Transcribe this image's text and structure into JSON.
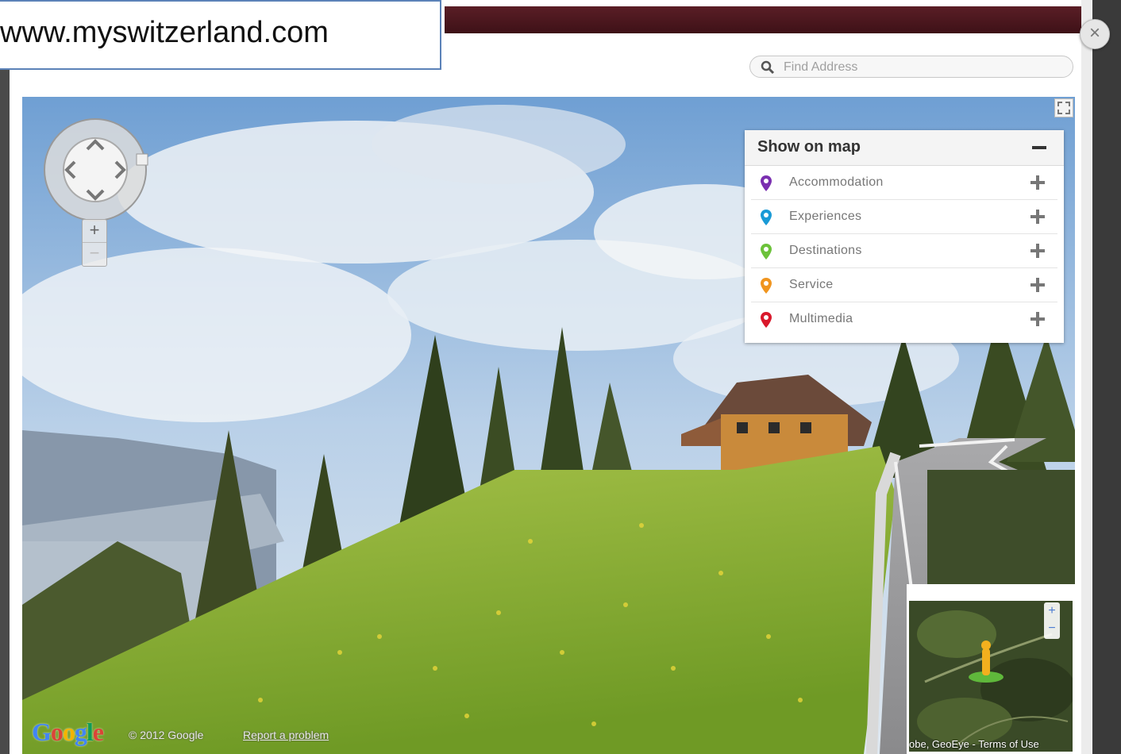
{
  "caption": {
    "url": "www.myswitzerland.com"
  },
  "search": {
    "placeholder": "Find Address",
    "icon": "search-icon"
  },
  "window": {
    "close_label": "×"
  },
  "poi_panel": {
    "title": "Show on map",
    "items": [
      {
        "label": "Accommodation",
        "color": "#7a2fb0"
      },
      {
        "label": "Experiences",
        "color": "#1a9ad6"
      },
      {
        "label": "Destinations",
        "color": "#6cc23a"
      },
      {
        "label": "Service",
        "color": "#f0951f"
      },
      {
        "label": "Multimedia",
        "color": "#d9182b"
      }
    ]
  },
  "streetview": {
    "zoom_in": "+",
    "zoom_out": "−",
    "logo": "Google",
    "copyright": "© 2012 Google",
    "report_link": "Report a problem"
  },
  "minimap": {
    "zoom_in": "+",
    "zoom_out": "−",
    "attribution": "obe, GeoEye - Terms of Use"
  },
  "colors": {
    "top_bar": "#4a1720",
    "caption_border": "#5b82b8",
    "google_blue": "#4285f4",
    "google_red": "#db4437",
    "google_yellow": "#f4b400",
    "google_green": "#0f9d58"
  }
}
